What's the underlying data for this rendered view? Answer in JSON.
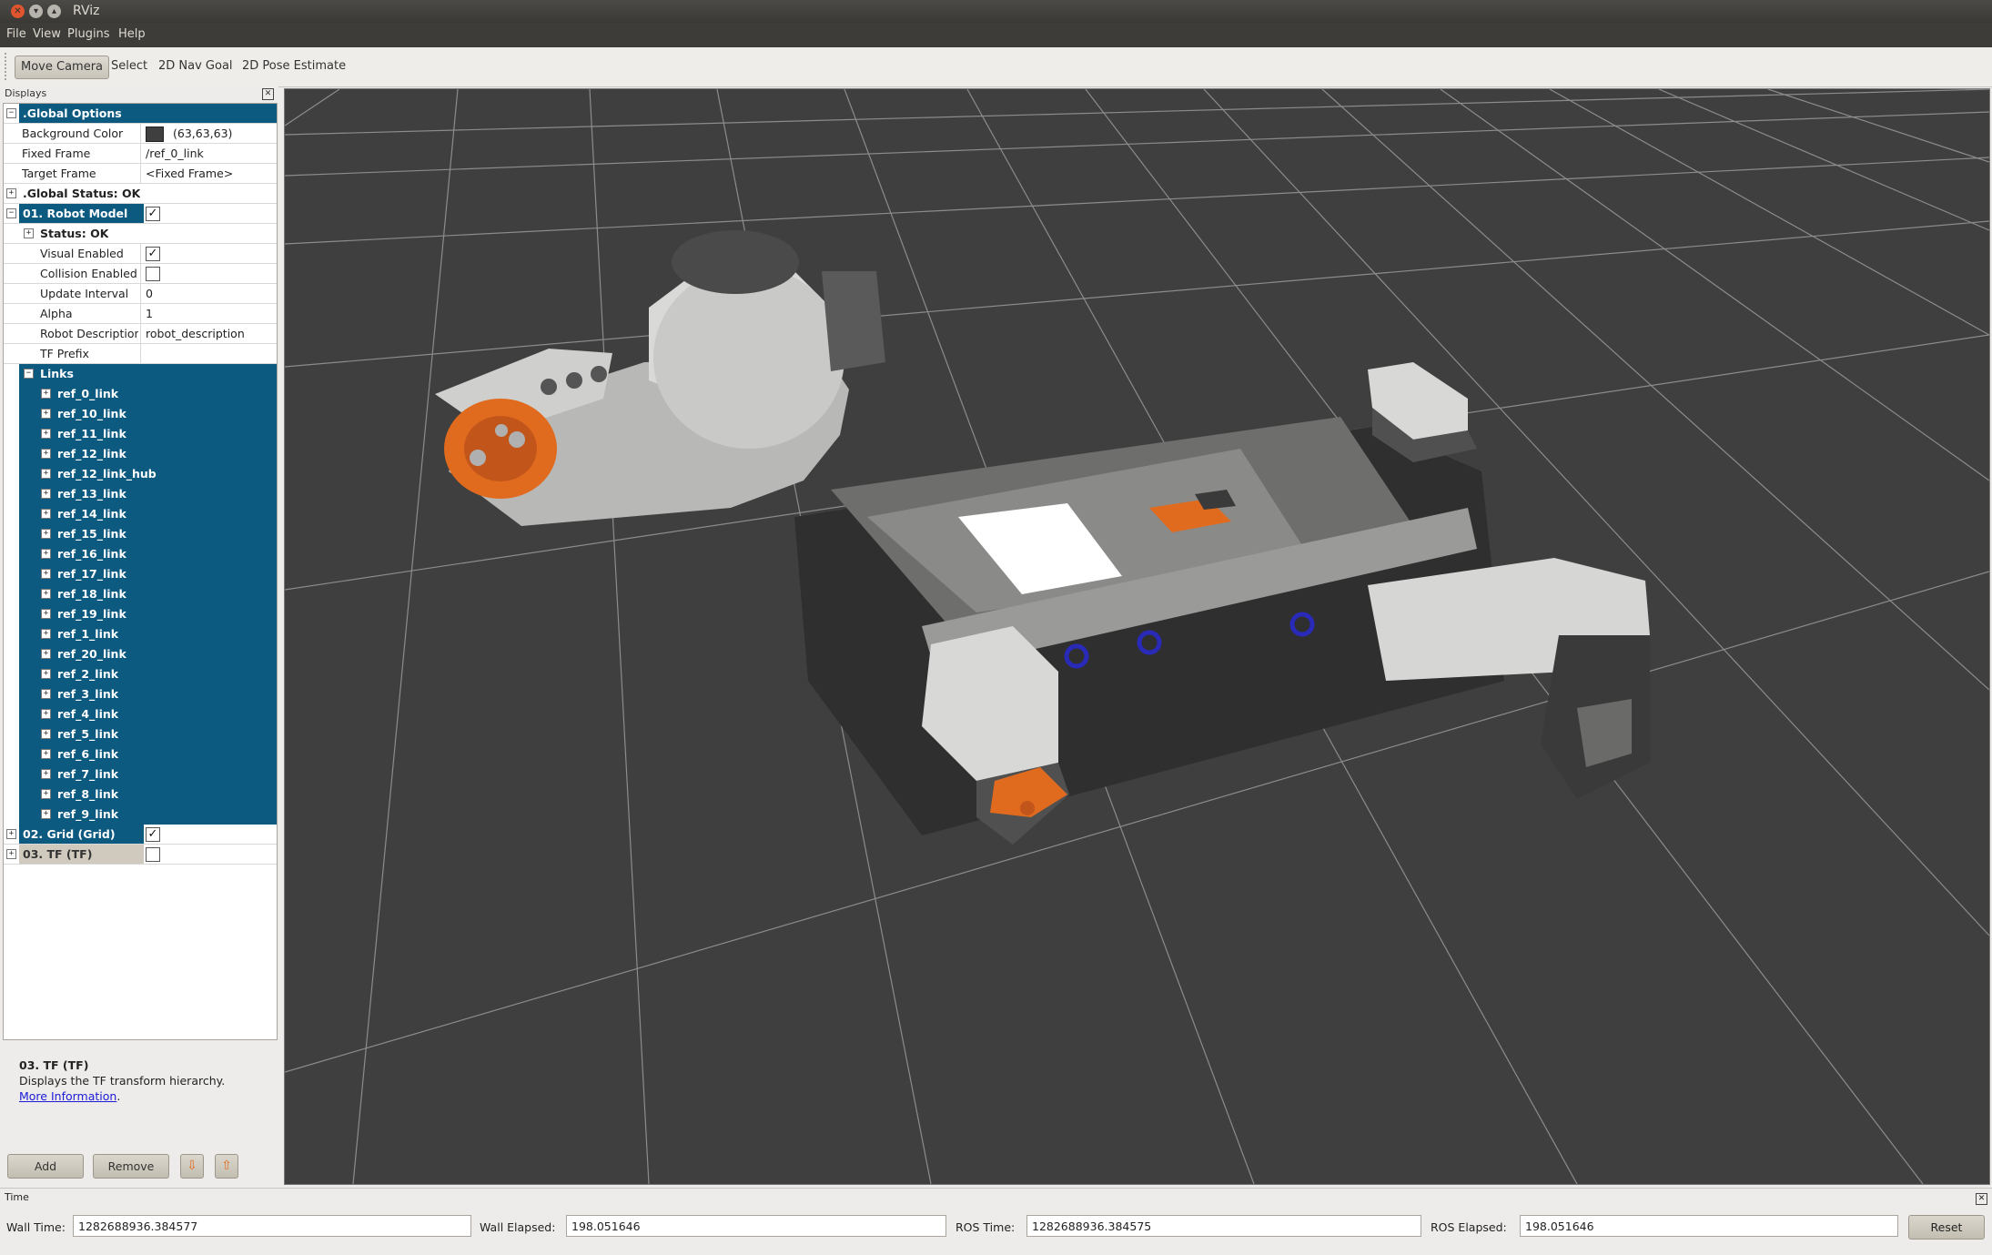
{
  "window": {
    "title": "RViz"
  },
  "menu": [
    "File",
    "View",
    "Plugins",
    "Help"
  ],
  "toolbar": {
    "tools": [
      "Move Camera",
      "Select",
      "2D Nav Goal",
      "2D Pose Estimate"
    ],
    "active": "Move Camera"
  },
  "displays": {
    "header": "Displays",
    "global_options": {
      "label": ".Global Options",
      "properties": [
        {
          "name": "Background Color",
          "value": "(63,63,63)",
          "color": "#3f3f3f"
        },
        {
          "name": "Fixed Frame",
          "value": "/ref_0_link"
        },
        {
          "name": "Target Frame",
          "value": "<Fixed Frame>"
        }
      ]
    },
    "global_status": ".Global Status: OK",
    "robot_model": {
      "label": "01. Robot Model",
      "enabled": true,
      "status": "Status: OK",
      "properties": [
        {
          "name": "Visual Enabled",
          "type": "check",
          "checked": true
        },
        {
          "name": "Collision Enabled",
          "type": "check",
          "checked": false
        },
        {
          "name": "Update Interval",
          "value": "0"
        },
        {
          "name": "Alpha",
          "value": "1"
        },
        {
          "name": "Robot Description",
          "value": "robot_description"
        },
        {
          "name": "TF Prefix",
          "value": ""
        }
      ],
      "links_label": "Links",
      "links": [
        "ref_0_link",
        "ref_10_link",
        "ref_11_link",
        "ref_12_link",
        "ref_12_link_hub",
        "ref_13_link",
        "ref_14_link",
        "ref_15_link",
        "ref_16_link",
        "ref_17_link",
        "ref_18_link",
        "ref_19_link",
        "ref_1_link",
        "ref_20_link",
        "ref_2_link",
        "ref_3_link",
        "ref_4_link",
        "ref_5_link",
        "ref_6_link",
        "ref_7_link",
        "ref_8_link",
        "ref_9_link"
      ]
    },
    "grid": {
      "label": "02. Grid (Grid)",
      "enabled": true
    },
    "tf": {
      "label": "03. TF (TF)",
      "enabled": false
    }
  },
  "description": {
    "title": "03. TF (TF)",
    "text": "Displays the TF transform hierarchy.",
    "link": "More Information",
    "link_suffix": "."
  },
  "buttons": {
    "add": "Add",
    "remove": "Remove"
  },
  "time": {
    "header": "Time",
    "wall_time_label": "Wall Time:",
    "wall_time": "1282688936.384577",
    "wall_elapsed_label": "Wall Elapsed:",
    "wall_elapsed": "198.051646",
    "ros_time_label": "ROS Time:",
    "ros_time": "1282688936.384575",
    "ros_elapsed_label": "ROS Elapsed:",
    "ros_elapsed": "198.051646",
    "reset": "Reset"
  },
  "colors": {
    "selection": "#0d5a81",
    "viewport_bg": "#3f3f3f",
    "accent_orange": "#e06a1e",
    "wheel_blue": "#2a2ab8"
  }
}
